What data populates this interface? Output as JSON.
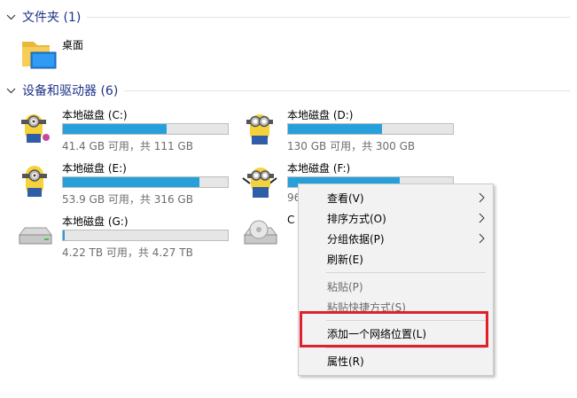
{
  "groups": {
    "folders": {
      "label": "文件夹 (1)"
    },
    "devices": {
      "label": "设备和驱动器 (6)"
    }
  },
  "folders": [
    {
      "name": "桌面",
      "icon": "desktop-folder-icon"
    }
  ],
  "drives": [
    {
      "name": "本地磁盘 (C:)",
      "space": "41.4 GB 可用，共 111 GB",
      "used_fraction": 0.63,
      "icon": "minion-drive-icon"
    },
    {
      "name": "本地磁盘 (D:)",
      "space": "130 GB 可用，共 300 GB",
      "used_fraction": 0.57,
      "icon": "minion-drive-icon"
    },
    {
      "name": "本地磁盘 (E:)",
      "space": "53.9 GB 可用，共 316 GB",
      "used_fraction": 0.83,
      "icon": "minion-drive-icon"
    },
    {
      "name": "本地磁盘 (F:)",
      "space": "96",
      "used_fraction": 0.68,
      "icon": "minion-drive-icon"
    },
    {
      "name": "本地磁盘 (G:)",
      "space": "4.22 TB 可用，共 4.27 TB",
      "used_fraction": 0.01,
      "icon": "hard-drive-icon"
    },
    {
      "name": "C",
      "icon": "optical-drive-icon"
    }
  ],
  "context_menu": {
    "items": [
      {
        "label": "查看(V)",
        "submenu": true,
        "enabled": true
      },
      {
        "label": "排序方式(O)",
        "submenu": true,
        "enabled": true
      },
      {
        "label": "分组依据(P)",
        "submenu": true,
        "enabled": true
      },
      {
        "label": "刷新(E)",
        "submenu": false,
        "enabled": true
      },
      {
        "label": "粘贴(P)",
        "submenu": false,
        "enabled": false
      },
      {
        "label": "粘贴快捷方式(S)",
        "submenu": false,
        "enabled": false
      },
      {
        "label": "添加一个网络位置(L)",
        "submenu": false,
        "enabled": true,
        "highlighted": true
      },
      {
        "label": "属性(R)",
        "submenu": false,
        "enabled": true
      }
    ]
  },
  "colors": {
    "group_header": "#1e3287",
    "bar_fill": "#26a0da",
    "highlight_box": "#e0202c"
  }
}
